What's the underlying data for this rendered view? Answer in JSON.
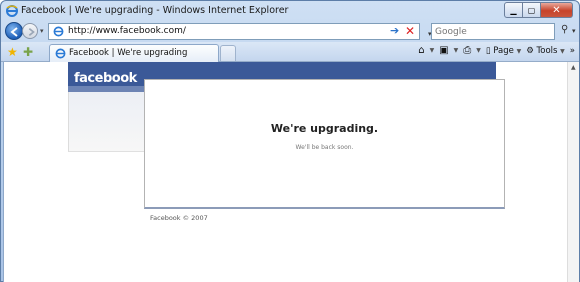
{
  "window": {
    "title": "Facebook | We're upgrading - Windows Internet Explorer",
    "minimize_icon": "minimize-icon",
    "maximize_icon": "maximize-icon",
    "close_icon": "close-icon"
  },
  "address_bar": {
    "url": "http://www.facebook.com/",
    "search_placeholder": "Google"
  },
  "tabs": [
    {
      "label": "Facebook | We're upgrading"
    }
  ],
  "command_bar": {
    "page_label": "Page",
    "tools_label": "Tools"
  },
  "page": {
    "logo": "facebook",
    "heading": "We're upgrading.",
    "subtext": "We'll be back soon.",
    "footer": "Facebook © 2007"
  },
  "colors": {
    "facebook_blue": "#3b5998",
    "ie_frame": "#b9d0ec"
  }
}
